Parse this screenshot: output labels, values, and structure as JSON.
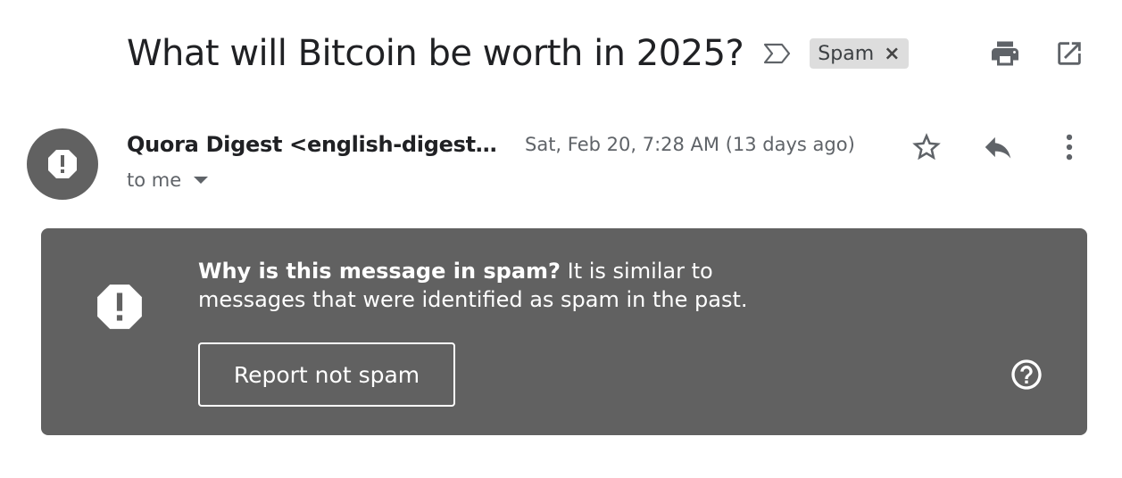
{
  "email": {
    "subject": "What will Bitcoin be worth in 2025?",
    "label": "Spam",
    "label_remove": "×",
    "sender": "Quora Digest <english-digest-n...",
    "date": "Sat, Feb 20, 7:28 AM (13 days ago)",
    "recipient": "to me"
  },
  "spam_banner": {
    "heading": "Why is this message in spam?",
    "reason": " It is similar to messages that were identified as spam in the past.",
    "report_button": "Report not spam"
  },
  "icons": {
    "important": "important-marker-icon",
    "print": "print-icon",
    "popout": "open-in-new-window-icon",
    "avatar": "warning-icon",
    "star": "star-icon",
    "reply": "reply-icon",
    "more": "more-vert-icon",
    "banner": "warning-icon",
    "help": "help-icon"
  },
  "colors": {
    "banner_bg": "#616161",
    "avatar_bg": "#616161",
    "chip_bg": "#dddddd",
    "text_primary": "#202124",
    "text_secondary": "#5f6368"
  }
}
